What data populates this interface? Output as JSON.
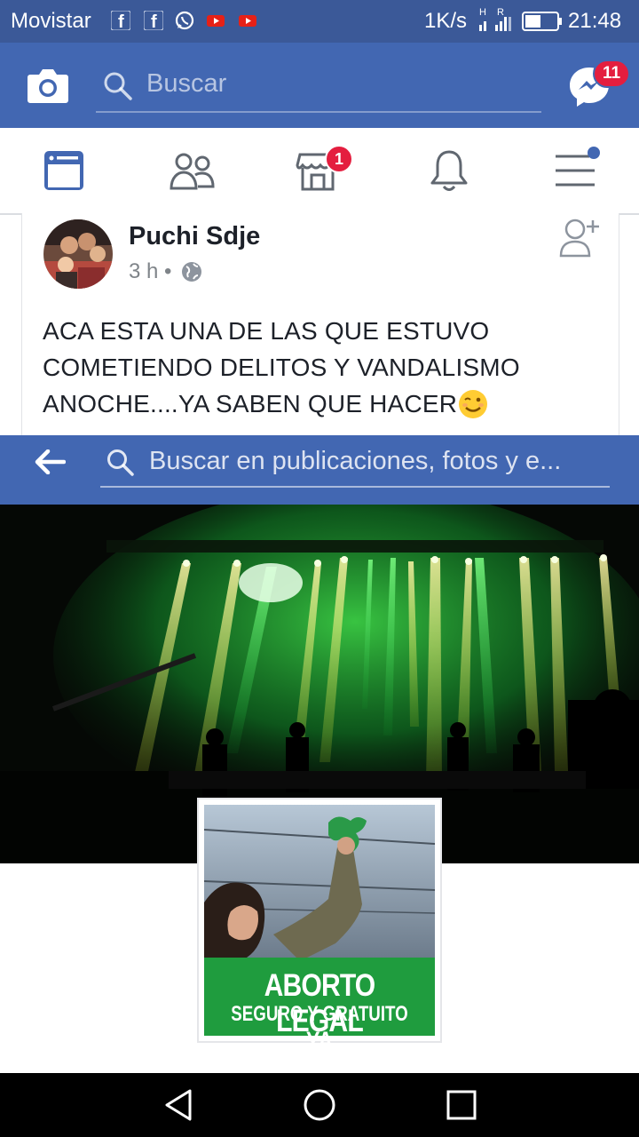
{
  "status_bar": {
    "carrier": "Movistar",
    "notification_icons": [
      "facebook-icon",
      "facebook-icon",
      "whatsapp-icon",
      "youtube-icon",
      "youtube-icon"
    ],
    "network_speed": "1K/s",
    "signal_labels": "H R",
    "time": "21:48"
  },
  "header": {
    "search_placeholder": "Buscar",
    "messenger_badge": "11"
  },
  "tabs": [
    {
      "name": "news-feed",
      "icon": "news-feed-icon",
      "active": true
    },
    {
      "name": "friends",
      "icon": "friends-icon"
    },
    {
      "name": "marketplace",
      "icon": "marketplace-icon",
      "badge": "1"
    },
    {
      "name": "notifications",
      "icon": "bell-icon"
    },
    {
      "name": "menu",
      "icon": "menu-icon",
      "dot": true
    }
  ],
  "post": {
    "author": "Puchi Sdje",
    "time": "3 h",
    "privacy_icon": "globe-icon",
    "text": "ACA ESTA UNA DE LAS QUE ESTUVO COMETIENDO DELITOS Y VANDALISMO ANOCHE....YA SABEN QUE HACER",
    "emoji": "wink-emoji"
  },
  "profile_header": {
    "search_placeholder": "Buscar en publicaciones, fotos y e..."
  },
  "profile_picture": {
    "banner_line1": "ABORTO LEGAL",
    "banner_line2_prefix": "SEGURO Y GRATUITO",
    "banner_line2_suffix": "YA"
  },
  "colors": {
    "facebook_blue": "#4267b2",
    "status_bar_blue": "#3b5998",
    "badge_red": "#e41e3f",
    "banner_green": "#1f9c3e",
    "cover_green": "#2bd13a",
    "cover_yellow": "#ffe65a"
  }
}
